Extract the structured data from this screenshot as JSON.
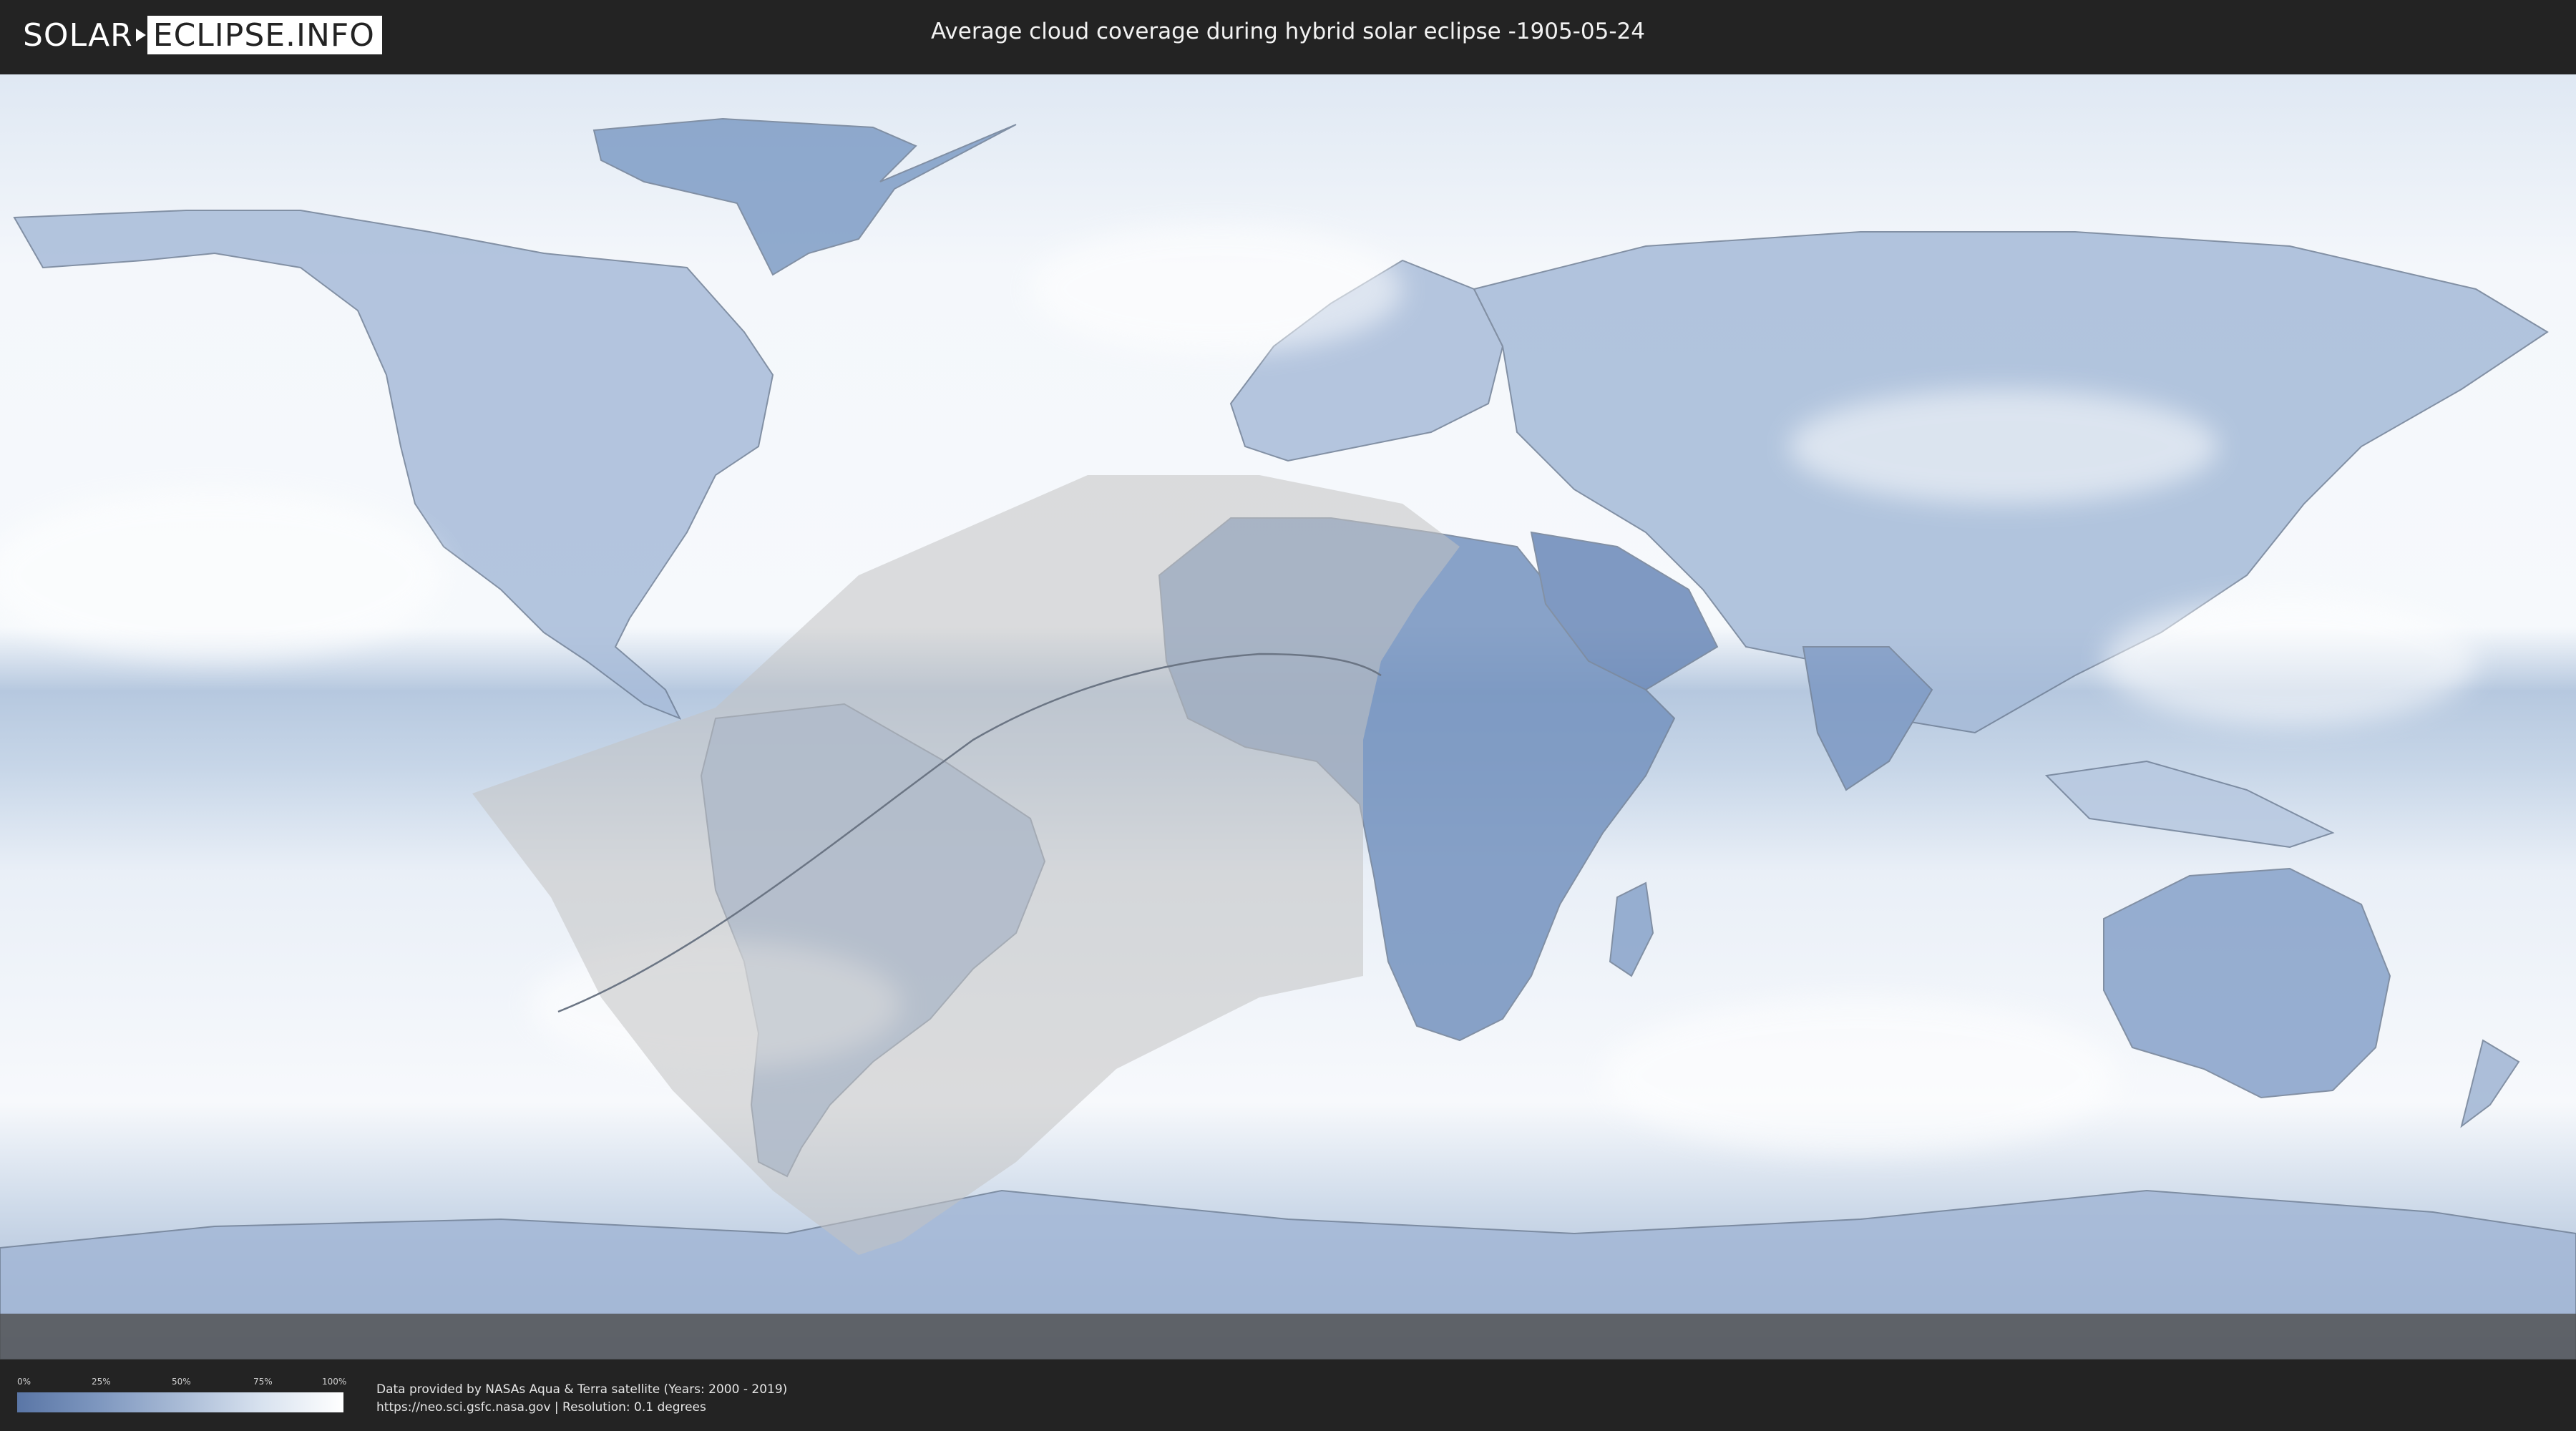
{
  "header": {
    "logo_part1": "SOLAR",
    "logo_part2": "ECLIPSE.INFO",
    "title": "Average cloud coverage during hybrid solar eclipse -1905-05-24"
  },
  "map": {
    "type": "cloud-coverage-equirectangular",
    "ocean_color": "#f3f7fb",
    "cloud_blue": "#5c7dac",
    "eclipse_shade": "#bdbdbd"
  },
  "legend": {
    "ticks": [
      "0%",
      "25%",
      "50%",
      "75%",
      "100%"
    ],
    "gradient_start": "#5a76a6",
    "gradient_end": "#ffffff"
  },
  "footer": {
    "credit_line1": "Data provided by NASAs Aqua & Terra satellite (Years: 2000 - 2019)",
    "credit_line2": "https://neo.sci.gsfc.nasa.gov | Resolution: 0.1 degrees"
  }
}
